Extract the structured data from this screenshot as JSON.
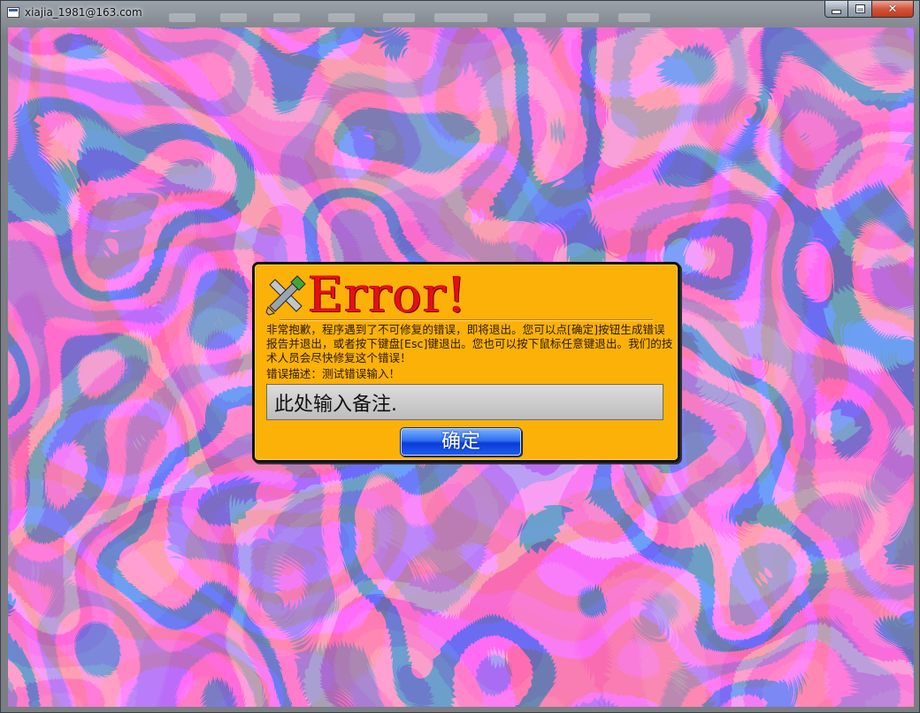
{
  "window": {
    "title": "xiajia_1981@163.com"
  },
  "dialog": {
    "heading": "Error!",
    "message": "非常抱歉，程序遇到了不可修复的错误，即将退出。您可以点[确定]按钮生成错误报告并退出，或者按下键盘[Esc]键退出。您也可以按下鼠标任意键退出。我们的技术人员会尽快修复这个错误！",
    "description": "错误描述：测试错误输入！",
    "note_value": "此处输入备注.",
    "ok_label": "确定",
    "icon": "crossed-tools-icon"
  },
  "colors": {
    "dialog_bg": "#fbb108",
    "title_red": "#e61010",
    "button_blue": "#1f5ef0",
    "background_pink": "#ff3a6e",
    "background_blue": "#2a2fa8"
  }
}
